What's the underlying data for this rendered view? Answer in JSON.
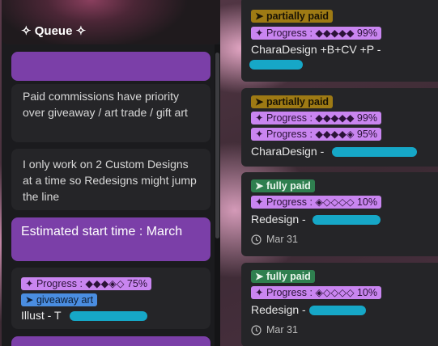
{
  "queue": {
    "title": "✧ Queue ✧",
    "notes": [
      "Paid commissions have priority over giveaway / art trade / gift art",
      "I only work on 2 Custom Designs at a time so Redesigns might jump the line"
    ],
    "estimate": "Estimated start time : March",
    "items": [
      {
        "progress": "✦ Progress : ◆◆◆◈◇ 75%",
        "type_tag": "➤ giveaway art",
        "name": "Illust - T"
      }
    ]
  },
  "board": {
    "cards": [
      {
        "status": "➤ partially paid",
        "progress": [
          "✦ Progress : ◆◆◆◆◆ 99%"
        ],
        "name": "CharaDesign +B+CV +P -"
      },
      {
        "status": "➤ partially paid",
        "progress": [
          "✦ Progress : ◆◆◆◆◆ 99%",
          "✦ Progress : ◆◆◆◆◈ 95%"
        ],
        "name": "CharaDesign -"
      },
      {
        "status": "➤ fully paid",
        "progress": [
          "✦ Progress : ◈◇◇◇◇ 10%"
        ],
        "name": "Redesign -",
        "date": "Mar 31"
      },
      {
        "status": "➤ fully paid",
        "progress": [
          "✦ Progress : ◈◇◇◇◇ 10%"
        ],
        "name": "Redesign -",
        "date": "Mar 31"
      }
    ]
  },
  "colors": {
    "purple_card": "#7b3fa8",
    "progress_tag": "#c985f0",
    "partial_tag": "#9e7a14",
    "full_tag": "#2f7f4f",
    "giveaway_tag": "#4a8de0",
    "redaction": "#16a7c7"
  },
  "icons": {
    "date": "clock-icon"
  }
}
